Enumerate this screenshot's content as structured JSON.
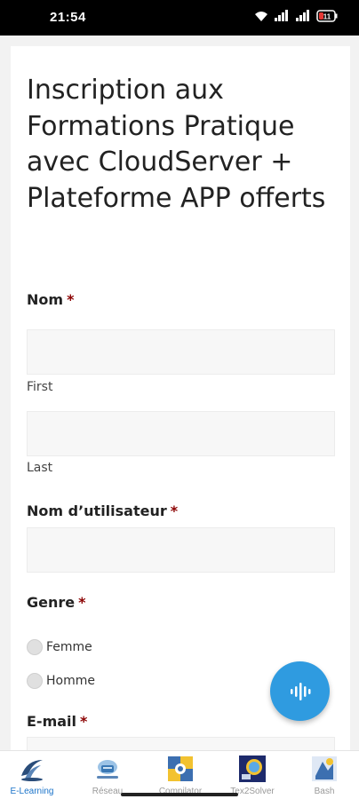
{
  "status_bar": {
    "time": "21:54",
    "icons": [
      "wifi-icon",
      "signal-icon",
      "signal-icon",
      "battery-icon"
    ],
    "battery_level": "11"
  },
  "form": {
    "title": "Inscription aux Formations Pratique avec CloudServer + Plateforme APP offerts",
    "required_mark": "*",
    "name_label": "Nom",
    "first_sublabel": "First",
    "last_sublabel": "Last",
    "username_label": "Nom d’utilisateur",
    "gender_label": "Genre",
    "gender_options": [
      "Femme",
      "Homme"
    ],
    "email_label": "E-mail"
  },
  "fab": {
    "icon": "voice-wave-icon",
    "color": "#2f9be0"
  },
  "bottom_nav": {
    "items": [
      {
        "label": "E-Learning",
        "icon": "elearning-icon",
        "active": true
      },
      {
        "label": "Réseau",
        "icon": "network-icon",
        "active": false
      },
      {
        "label": "Compilator",
        "icon": "compilator-icon",
        "active": false
      },
      {
        "label": "Tex2Solver",
        "icon": "tex2solver-icon",
        "active": false
      },
      {
        "label": "Bash",
        "icon": "bash-icon",
        "active": false
      }
    ]
  },
  "colors": {
    "accent": "#2f9be0",
    "required": "#8b0000",
    "active_nav": "#1a73c9"
  }
}
